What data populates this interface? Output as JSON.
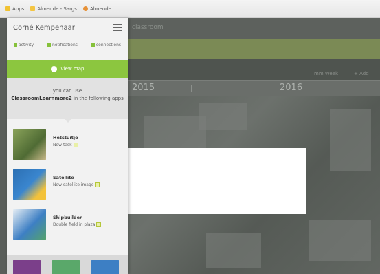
{
  "browser": {
    "bookmarks": [
      {
        "label": "Apps",
        "icon": "apps-icon",
        "color": "#f1c232"
      },
      {
        "label": "Almende - Sargs",
        "icon": "folder-icon",
        "color": "#f4c542"
      },
      {
        "label": "Almende",
        "icon": "bookmark-icon",
        "color": "#e69138"
      }
    ]
  },
  "sidebar": {
    "user_name": "Corné Kempenaar",
    "stats": [
      {
        "label": "activity"
      },
      {
        "label": "notifications"
      },
      {
        "label": "connections"
      }
    ],
    "primary_button": "view map",
    "info_line1": "you can use",
    "info_app": "ClassroomLearnmore2",
    "info_rest": "in the following apps",
    "apps": [
      {
        "name": "Hetstuitje",
        "sub": "New task"
      },
      {
        "name": "Satellite",
        "sub": "New satellite image"
      },
      {
        "name": "Shipbuilder",
        "sub": "Double field in plaza"
      }
    ]
  },
  "background": {
    "header_title": "classroom",
    "toolbar_items": [
      "mm Week",
      "+ Add"
    ],
    "timeline_year": "2016",
    "timeline_left": "2015"
  },
  "colors": {
    "accent_green": "#8cc63f",
    "bg_green": "#7b8a55"
  }
}
